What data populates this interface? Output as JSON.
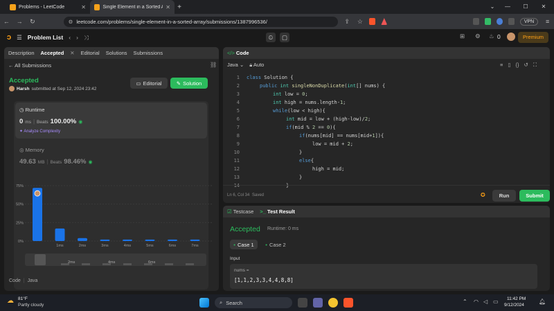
{
  "browser": {
    "tabs": [
      {
        "title": "Problems - LeetCode",
        "active": false
      },
      {
        "title": "Single Element in a Sorted Arr",
        "active": true
      }
    ],
    "url": "leetcode.com/problems/single-element-in-a-sorted-array/submissions/1387996536/",
    "vpn_label": "VPN"
  },
  "nav": {
    "problem_list": "Problem List",
    "coins": "0",
    "premium": "Premium"
  },
  "left": {
    "tabs": [
      "Description",
      "Accepted",
      "Editorial",
      "Solutions",
      "Submissions"
    ],
    "all_submissions": "All Submissions",
    "status": "Accepted",
    "user": "Harsh",
    "submitted_text": "submitted at Sep 12, 2024 23:42",
    "editorial_btn": "Editorial",
    "solution_btn": "Solution",
    "runtime": {
      "label": "Runtime",
      "value": "0",
      "unit": "ms",
      "beats_label": "Beats",
      "beats": "100.00%",
      "analyze": "Analyze Complexity"
    },
    "memory": {
      "label": "Memory",
      "value": "49.63",
      "unit": "MB",
      "beats_label": "Beats",
      "beats": "98.46%"
    },
    "footer_code": "Code",
    "footer_lang": "Java"
  },
  "chart_data": {
    "type": "bar",
    "categories": [
      "0ms",
      "1ms",
      "2ms",
      "3ms",
      "4ms",
      "5ms",
      "6ms",
      "7ms"
    ],
    "values": [
      72,
      17,
      4,
      2,
      2,
      2,
      2,
      2
    ],
    "y_ticks": [
      "75%",
      "50%",
      "25%",
      "0%"
    ],
    "ylim": [
      0,
      75
    ],
    "x_labels": [
      "",
      "1ms",
      "2ms",
      "3ms",
      "4ms",
      "5ms",
      "6ms",
      "7ms"
    ],
    "mini_labels": [
      "2ms",
      "4ms",
      "6ms"
    ],
    "grid": true,
    "bar_color": "#1a73e8"
  },
  "code": {
    "title": "Code",
    "lang": "Java",
    "auto": "Auto",
    "lines": [
      {
        "n": "1",
        "indent": 0,
        "text": "class Solution {"
      },
      {
        "n": "2",
        "indent": 1,
        "text": "public int singleNonDuplicate(int[] nums) {"
      },
      {
        "n": "3",
        "indent": 2,
        "text": "int low = 0;"
      },
      {
        "n": "4",
        "indent": 2,
        "text": "int high = nums.length-1;"
      },
      {
        "n": "5",
        "indent": 2,
        "text": "while(low < high){"
      },
      {
        "n": "6",
        "indent": 3,
        "text": "int mid = low + (high-low)/2;"
      },
      {
        "n": "7",
        "indent": 3,
        "text": "if(mid % 2 == 0){"
      },
      {
        "n": "8",
        "indent": 4,
        "text": "if(nums[mid] == nums[mid+1]){"
      },
      {
        "n": "9",
        "indent": 5,
        "text": "low = mid + 2;"
      },
      {
        "n": "10",
        "indent": 4,
        "text": "}"
      },
      {
        "n": "11",
        "indent": 4,
        "text": "else{"
      },
      {
        "n": "12",
        "indent": 5,
        "text": "high = mid;"
      },
      {
        "n": "13",
        "indent": 4,
        "text": "}"
      },
      {
        "n": "14",
        "indent": 3,
        "text": "}"
      }
    ],
    "cursor": "Ln 6, Col 34",
    "saved": "Saved",
    "run": "Run",
    "submit": "Submit"
  },
  "test": {
    "tab_testcase": "Testcase",
    "tab_result": "Test Result",
    "status": "Accepted",
    "runtime": "Runtime: 0 ms",
    "case1": "Case 1",
    "case2": "Case 2",
    "input_label": "Input",
    "param": "nums =",
    "value": "[1,1,2,3,3,4,4,8,8]"
  },
  "taskbar": {
    "temp": "81°F",
    "weather": "Partly cloudy",
    "search": "Search",
    "time": "11:42 PM",
    "date": "9/12/2024"
  },
  "colors": {
    "accent": "#ffa116",
    "green": "#2cbb5d",
    "blue": "#1a73e8"
  }
}
